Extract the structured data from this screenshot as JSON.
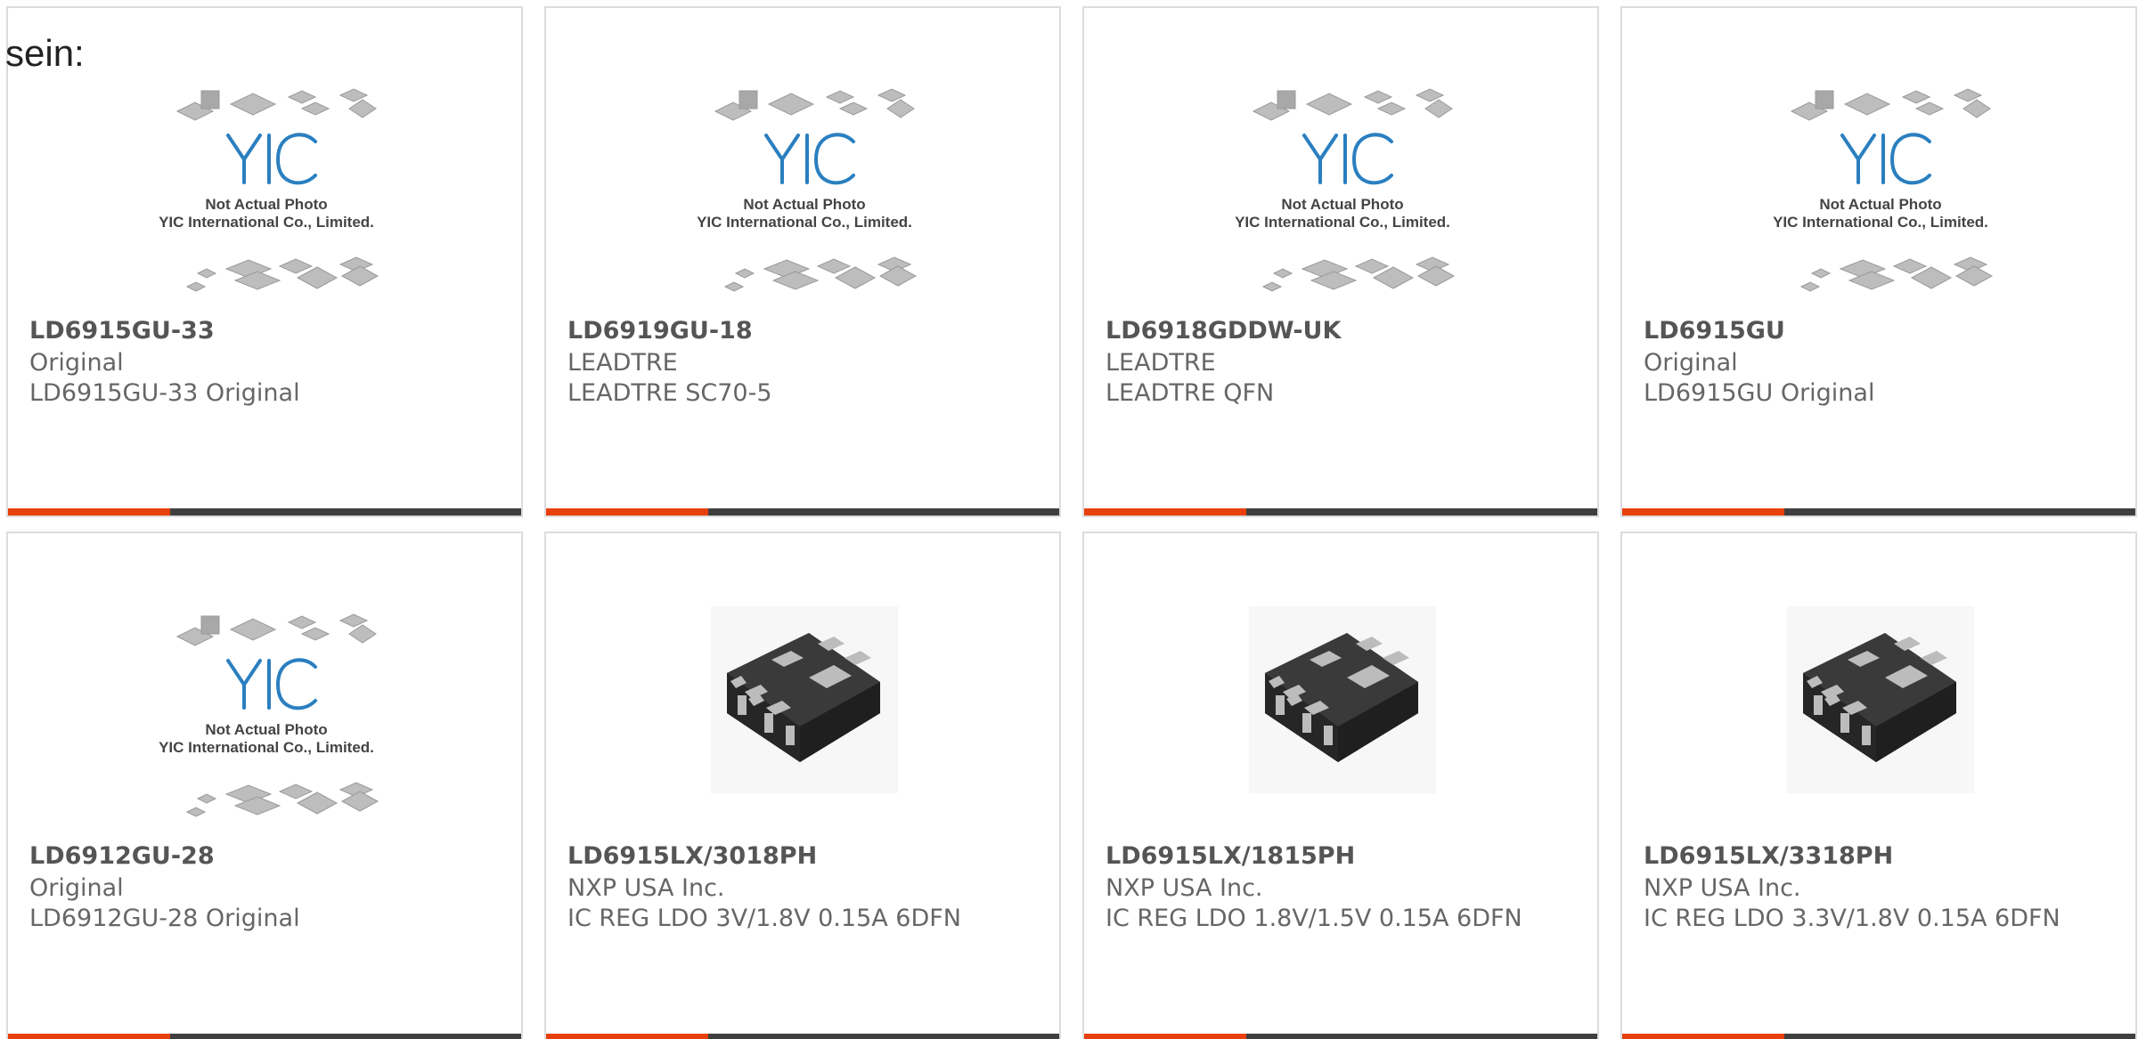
{
  "intro_text": "sein:",
  "colors": {
    "accent": "#e8400c",
    "bar": "#3f3f3f",
    "border": "#dcdcdc"
  },
  "placeholder_image": {
    "caption_line1": "Not Actual Photo",
    "caption_line2": "YIC International Co., Limited.",
    "logo_text": "YIC",
    "icon": "chip-placeholder-image"
  },
  "products": [
    {
      "part": "LD6915GU-33",
      "manufacturer": "Original",
      "description": "LD6915GU-33 Original",
      "image": "placeholder"
    },
    {
      "part": "LD6919GU-18",
      "manufacturer": "LEADTRE",
      "description": "LEADTRE SC70-5",
      "image": "placeholder"
    },
    {
      "part": "LD6918GDDW-UK",
      "manufacturer": "LEADTRE",
      "description": "LEADTRE QFN",
      "image": "placeholder"
    },
    {
      "part": "LD6915GU",
      "manufacturer": "Original",
      "description": "LD6915GU Original",
      "image": "placeholder"
    },
    {
      "part": "LD6912GU-28",
      "manufacturer": "Original",
      "description": "LD6912GU-28 Original",
      "image": "placeholder"
    },
    {
      "part": "LD6915LX/3018PH",
      "manufacturer": "NXP USA Inc.",
      "description": "IC REG LDO 3V/1.8V 0.15A 6DFN",
      "image": "dfn"
    },
    {
      "part": "LD6915LX/1815PH",
      "manufacturer": "NXP USA Inc.",
      "description": "IC REG LDO 1.8V/1.5V 0.15A 6DFN",
      "image": "dfn"
    },
    {
      "part": "LD6915LX/3318PH",
      "manufacturer": "NXP USA Inc.",
      "description": "IC REG LDO 3.3V/1.8V 0.15A 6DFN",
      "image": "dfn"
    }
  ]
}
